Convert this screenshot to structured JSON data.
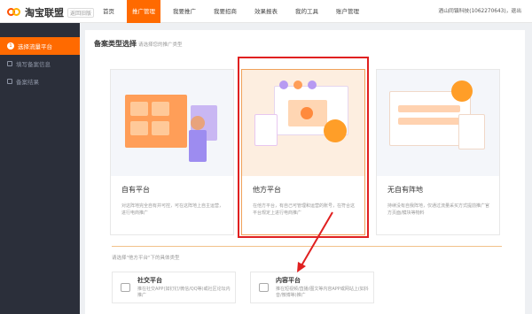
{
  "header": {
    "logo_text": "淘宝联盟",
    "logo_tag": "返回旧版",
    "nav": [
      {
        "label": "首页",
        "active": false
      },
      {
        "label": "推广管理",
        "active": true
      },
      {
        "label": "我要推广",
        "active": false
      },
      {
        "label": "我要招商",
        "active": false
      },
      {
        "label": "效果报表",
        "active": false
      },
      {
        "label": "我的工具",
        "active": false
      },
      {
        "label": "账户管理",
        "active": false
      }
    ],
    "user": "酒山同镇科技(1062270643)，退出"
  },
  "sidebar": {
    "steps": [
      {
        "num": "1",
        "label": "选择流量平台",
        "active": true
      },
      {
        "label": "填写备案信息",
        "active": false
      },
      {
        "label": "备案结果",
        "active": false
      }
    ]
  },
  "main": {
    "title": "备案类型选择",
    "subtitle": "请选择您的推广类型",
    "cards": [
      {
        "name": "自有平台",
        "desc": "对这阵地完全自有并可控，可在这阵地上自主运营，进行电商推广"
      },
      {
        "name": "他方平台",
        "desc": "在他方平台，有自己可管理和运营的账号，在符合这平台规定上进行电商推广"
      },
      {
        "name": "无自有阵地",
        "desc": "持续没有自我阵地，仅通过流量采买方式提前推广官方页面/模块等物料"
      }
    ],
    "hint": "请选择\"他方平台\"下的具体类型",
    "subtypes": [
      {
        "title": "社交平台",
        "desc": "推在社交APP(如钉钉/微信/QQ等)或社区论坛内推广"
      },
      {
        "title": "内容平台",
        "desc": "推在短视频/直播/图文等内容APP或网站上(如抖音/微博等)推广"
      }
    ]
  },
  "colors": {
    "accent": "#ff6a00",
    "highlight_box": "#e02020"
  }
}
